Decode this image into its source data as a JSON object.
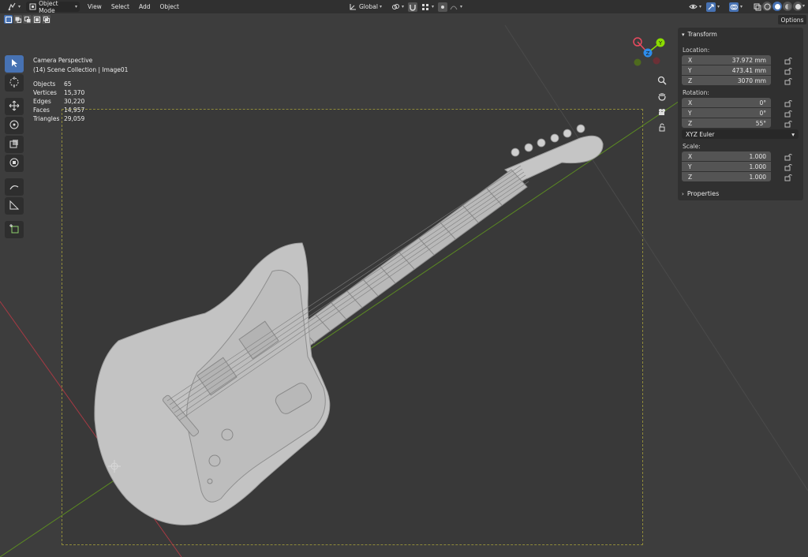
{
  "header": {
    "mode_label": "Object Mode",
    "menus": [
      "View",
      "Select",
      "Add",
      "Object"
    ],
    "transform_orientation": "Global",
    "options_label": "Options"
  },
  "overlay": {
    "view_name": "Camera Perspective",
    "collection": "(14) Scene Collection | Image01",
    "stats": [
      {
        "key": "Objects",
        "value": "65"
      },
      {
        "key": "Vertices",
        "value": "15,370"
      },
      {
        "key": "Edges",
        "value": "30,220"
      },
      {
        "key": "Faces",
        "value": "14,957"
      },
      {
        "key": "Triangles",
        "value": "29,059"
      }
    ]
  },
  "gizmo": {
    "x": "X",
    "y": "Y",
    "z": "Z"
  },
  "npanel": {
    "transform_title": "Transform",
    "location_label": "Location:",
    "location": [
      {
        "axis": "X",
        "value": "37.972 mm"
      },
      {
        "axis": "Y",
        "value": "473.41 mm"
      },
      {
        "axis": "Z",
        "value": "3070 mm"
      }
    ],
    "rotation_label": "Rotation:",
    "rotation": [
      {
        "axis": "X",
        "value": "0°"
      },
      {
        "axis": "Y",
        "value": "0°"
      },
      {
        "axis": "Z",
        "value": "55°"
      }
    ],
    "rotation_mode": "XYZ Euler",
    "scale_label": "Scale:",
    "scale": [
      {
        "axis": "X",
        "value": "1.000"
      },
      {
        "axis": "Y",
        "value": "1.000"
      },
      {
        "axis": "Z",
        "value": "1.000"
      }
    ],
    "properties_title": "Properties"
  },
  "colors": {
    "accent": "#4772b3",
    "axis_x": "#e84a5f",
    "axis_y": "#8bdc00",
    "axis_z": "#2d8ceb",
    "viewport_bg": "#3d3d3d"
  }
}
